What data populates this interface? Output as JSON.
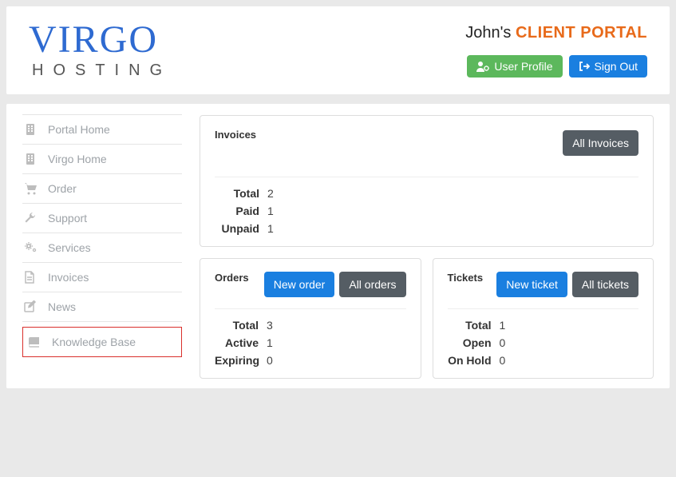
{
  "header": {
    "logo_line1": "VIRGO",
    "logo_line2": "HOSTING",
    "title_prefix": "John's ",
    "title_suffix": "CLIENT PORTAL",
    "user_profile_label": "User Profile",
    "sign_out_label": "Sign Out"
  },
  "sidebar": {
    "items": [
      {
        "label": "Portal Home",
        "icon": "building-icon"
      },
      {
        "label": "Virgo Home",
        "icon": "building-icon"
      },
      {
        "label": "Order",
        "icon": "cart-icon"
      },
      {
        "label": "Support",
        "icon": "wrench-icon"
      },
      {
        "label": "Services",
        "icon": "gears-icon"
      },
      {
        "label": "Invoices",
        "icon": "file-icon"
      },
      {
        "label": "News",
        "icon": "edit-icon"
      },
      {
        "label": "Knowledge Base",
        "icon": "book-icon",
        "highlight": true
      }
    ]
  },
  "cards": {
    "invoices": {
      "title": "Invoices",
      "all_button": "All Invoices",
      "stats": [
        {
          "label": "Total",
          "value": "2"
        },
        {
          "label": "Paid",
          "value": "1"
        },
        {
          "label": "Unpaid",
          "value": "1"
        }
      ]
    },
    "orders": {
      "title": "Orders",
      "new_button": "New order",
      "all_button": "All orders",
      "stats": [
        {
          "label": "Total",
          "value": "3"
        },
        {
          "label": "Active",
          "value": "1"
        },
        {
          "label": "Expiring",
          "value": "0"
        }
      ]
    },
    "tickets": {
      "title": "Tickets",
      "new_button": "New ticket",
      "all_button": "All tickets",
      "stats": [
        {
          "label": "Total",
          "value": "1"
        },
        {
          "label": "Open",
          "value": "0"
        },
        {
          "label": "On Hold",
          "value": "0"
        }
      ]
    }
  }
}
